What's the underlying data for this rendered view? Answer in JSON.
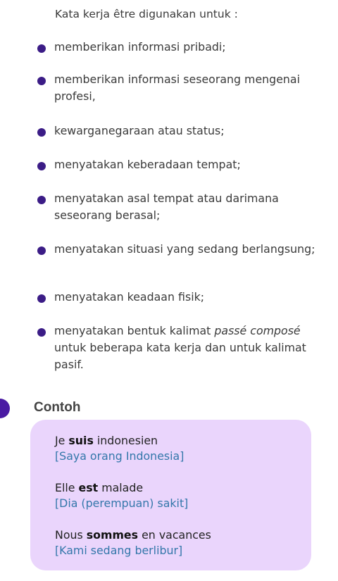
{
  "intro": "Kata kerja être digunakan untuk :",
  "items": [
    {
      "text": "memberikan informasi pribadi;"
    },
    {
      "text": "memberikan informasi seseorang mengenai profesi,"
    },
    {
      "text": "kewarganegaraan atau status;"
    },
    {
      "text": "menyatakan keberadaan tempat;"
    },
    {
      "text": "menyatakan asal tempat atau darimana seseorang berasal;"
    },
    {
      "text": "menyatakan situasi yang sedang berlangsung;"
    },
    {
      "text": "menyatakan keadaan fisik;"
    },
    {
      "before": "menyatakan bentuk kalimat ",
      "em": "passé composé",
      "after": " untuk beberapa kata kerja dan untuk kalimat pasif."
    }
  ],
  "section_title": "Contoh",
  "examples": [
    {
      "pre": "Je ",
      "bold": "suis",
      "post": " indonesien",
      "translation": "[Saya orang Indonesia]"
    },
    {
      "pre": "Elle ",
      "bold": "est",
      "post": " malade",
      "translation": "[Dia (perempuan) sakit]"
    },
    {
      "pre": "Nous ",
      "bold": "sommes",
      "post": " en vacances",
      "translation": "[Kami sedang berlibur]"
    }
  ],
  "colors": {
    "bullet": "#3b1c86",
    "box": "#ead5fc",
    "translation": "#3377aa"
  }
}
